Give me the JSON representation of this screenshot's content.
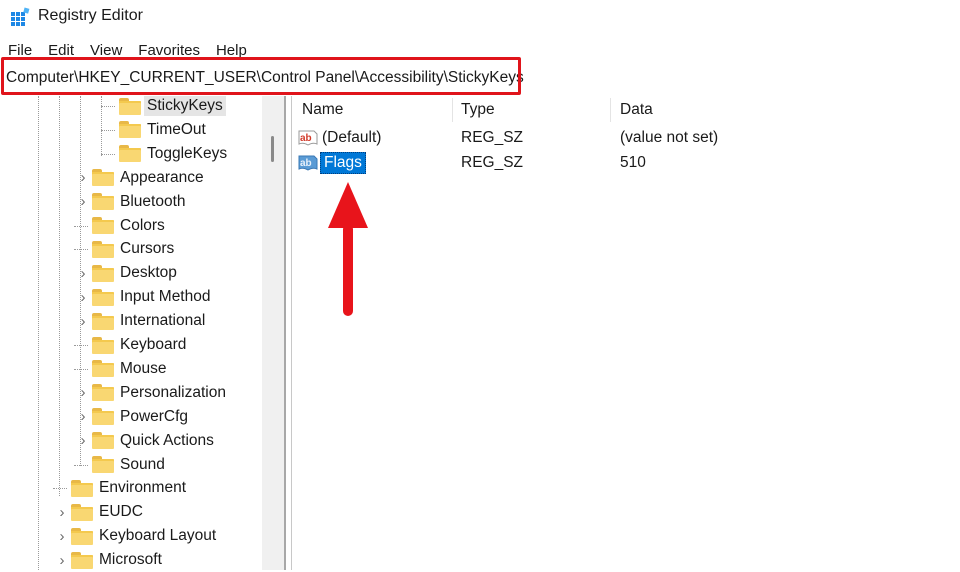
{
  "window": {
    "title": "Registry Editor",
    "icon": "registry-editor-icon"
  },
  "menu": [
    "File",
    "Edit",
    "View",
    "Favorites",
    "Help"
  ],
  "address_bar": {
    "value": "Computer\\HKEY_CURRENT_USER\\Control Panel\\Accessibility\\StickyKeys",
    "highlight_color": "#e0141b"
  },
  "tree": {
    "items": [
      {
        "label": "StickyKeys",
        "expandable": false,
        "selected": true
      },
      {
        "label": "TimeOut",
        "expandable": false,
        "selected": false
      },
      {
        "label": "ToggleKeys",
        "expandable": false,
        "selected": false
      },
      {
        "label": "Appearance",
        "expandable": true,
        "selected": false
      },
      {
        "label": "Bluetooth",
        "expandable": true,
        "selected": false
      },
      {
        "label": "Colors",
        "expandable": false,
        "selected": false
      },
      {
        "label": "Cursors",
        "expandable": false,
        "selected": false
      },
      {
        "label": "Desktop",
        "expandable": true,
        "selected": false
      },
      {
        "label": "Input Method",
        "expandable": true,
        "selected": false
      },
      {
        "label": "International",
        "expandable": true,
        "selected": false
      },
      {
        "label": "Keyboard",
        "expandable": false,
        "selected": false
      },
      {
        "label": "Mouse",
        "expandable": false,
        "selected": false
      },
      {
        "label": "Personalization",
        "expandable": true,
        "selected": false
      },
      {
        "label": "PowerCfg",
        "expandable": true,
        "selected": false
      },
      {
        "label": "Quick Actions",
        "expandable": true,
        "selected": false
      },
      {
        "label": "Sound",
        "expandable": false,
        "selected": false
      },
      {
        "label": "Environment",
        "expandable": false,
        "selected": false
      },
      {
        "label": "EUDC",
        "expandable": true,
        "selected": false
      },
      {
        "label": "Keyboard Layout",
        "expandable": true,
        "selected": false
      },
      {
        "label": "Microsoft",
        "expandable": true,
        "selected": false
      }
    ]
  },
  "list": {
    "columns": [
      "Name",
      "Type",
      "Data"
    ],
    "rows": [
      {
        "name": "(Default)",
        "type": "REG_SZ",
        "data": "(value not set)",
        "icon": "string-value-icon",
        "selected": false
      },
      {
        "name": "Flags",
        "type": "REG_SZ",
        "data": "510",
        "icon": "string-value-icon",
        "selected": true
      }
    ]
  },
  "annotation": {
    "arrow_color": "#e8141b",
    "points_to": "Flags"
  },
  "colors": {
    "selection_blue": "#0078d7",
    "folder_yellow": "#f9d772"
  }
}
